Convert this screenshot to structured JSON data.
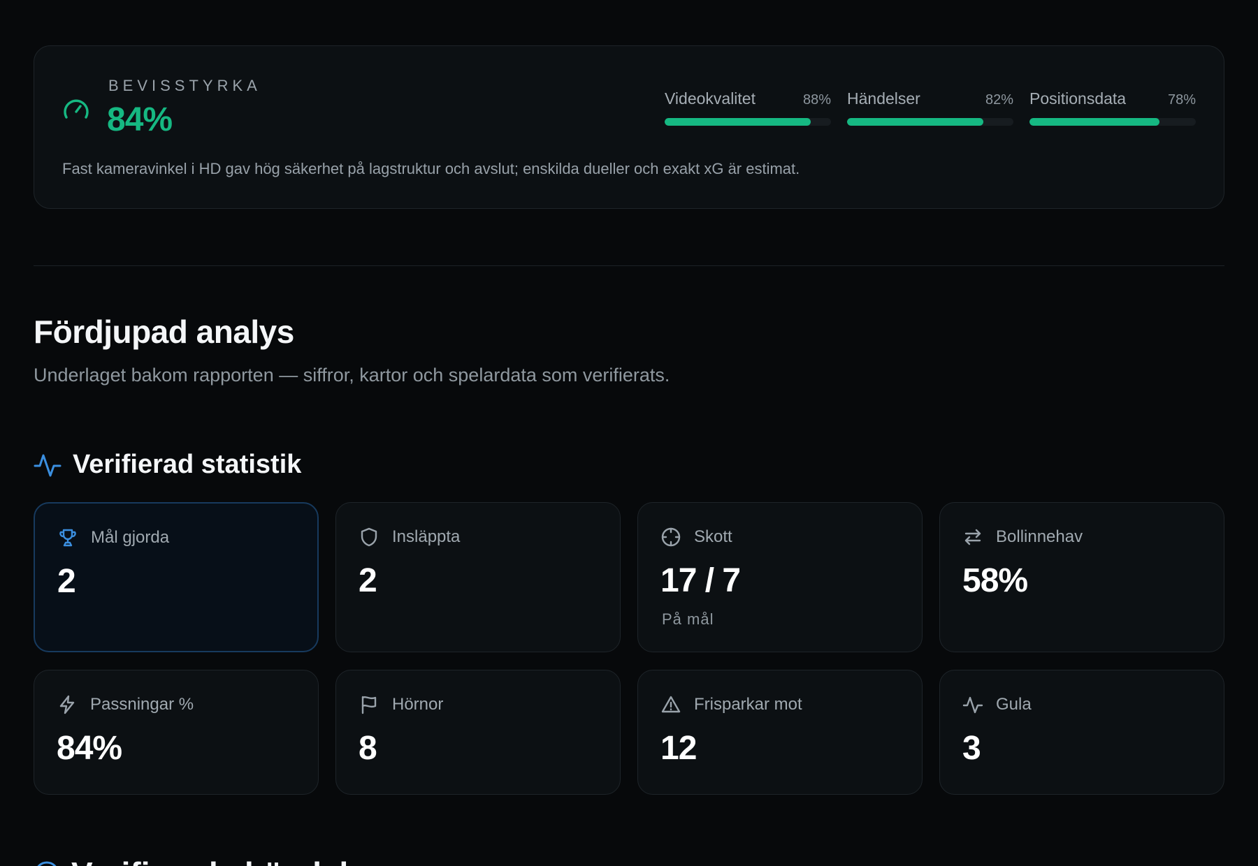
{
  "confidence": {
    "label": "BEVISSTYRKA",
    "value": "84%",
    "note": "Fast kameravinkel i HD gav hög säkerhet på lagstruktur och avslut; enskilda dueller och exakt xG är estimat.",
    "metrics": [
      {
        "name": "Videokvalitet",
        "pct_label": "88%",
        "level": 88
      },
      {
        "name": "Händelser",
        "pct_label": "82%",
        "level": 82
      },
      {
        "name": "Positionsdata",
        "pct_label": "78%",
        "level": 78
      }
    ],
    "accent": "#16b882"
  },
  "section": {
    "title": "Fördjupad analys",
    "subtitle": "Underlaget bakom rapporten — siffror, kartor och spelardata som verifierats."
  },
  "stats": {
    "title": "Verifierad statistik",
    "accent": "#3b8fe0",
    "cards": [
      {
        "icon": "trophy-icon",
        "label": "Mål gjorda",
        "value": "2",
        "sub": ""
      },
      {
        "icon": "shield-icon",
        "label": "Insläppta",
        "value": "2",
        "sub": ""
      },
      {
        "icon": "crosshair-icon",
        "label": "Skott",
        "value": "17 / 7",
        "sub": "På mål"
      },
      {
        "icon": "swap-arrows-icon",
        "label": "Bollinnehav",
        "value": "58%",
        "sub": ""
      },
      {
        "icon": "lightning-icon",
        "label": "Passningar %",
        "value": "84%",
        "sub": ""
      },
      {
        "icon": "flag-icon",
        "label": "Hörnor",
        "value": "8",
        "sub": ""
      },
      {
        "icon": "warning-icon",
        "label": "Frisparkar mot",
        "value": "12",
        "sub": ""
      },
      {
        "icon": "activity-icon",
        "label": "Gula",
        "value": "3",
        "sub": ""
      }
    ]
  },
  "next_section": {
    "title": "Verifierade händelser"
  }
}
